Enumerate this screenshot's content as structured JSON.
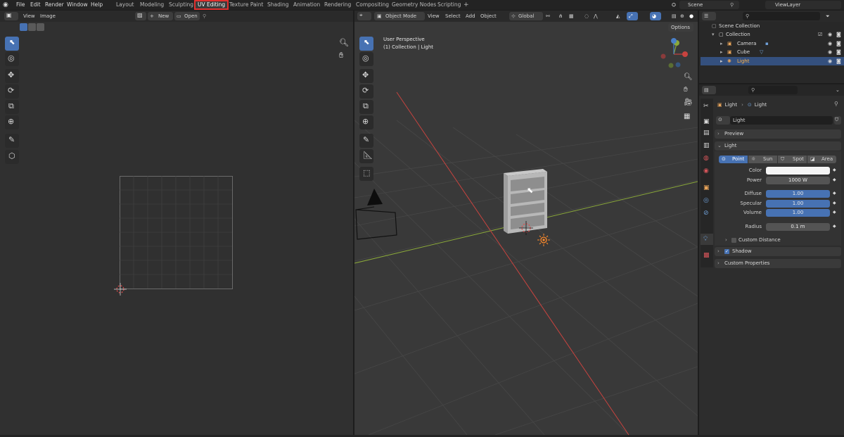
{
  "menus": [
    "File",
    "Edit",
    "Render",
    "Window",
    "Help"
  ],
  "workspaces": [
    {
      "label": "Layout",
      "active": false
    },
    {
      "label": "Modeling",
      "active": false
    },
    {
      "label": "Sculpting",
      "active": false
    },
    {
      "label": "UV Editing",
      "active": true
    },
    {
      "label": "Texture Paint",
      "active": false
    },
    {
      "label": "Shading",
      "active": false
    },
    {
      "label": "Animation",
      "active": false
    },
    {
      "label": "Rendering",
      "active": false
    },
    {
      "label": "Compositing",
      "active": false
    },
    {
      "label": "Geometry Nodes",
      "active": false
    },
    {
      "label": "Scripting",
      "active": false
    }
  ],
  "add_workspace": "+",
  "scene": {
    "name": "Scene",
    "view_layer": "ViewLayer"
  },
  "uv_editor": {
    "menus": [
      "View",
      "Image"
    ],
    "new_label": "New",
    "open_label": "Open",
    "new_plus": "+"
  },
  "viewport": {
    "mode": "Object Mode",
    "menus": [
      "View",
      "Select",
      "Add",
      "Object"
    ],
    "transform_orientation": "Global",
    "options_label": "Options",
    "perspective": "User Perspective",
    "collection_info": "(1) Collection | Light",
    "gizmo": {
      "x": "X",
      "y": "Y",
      "z": "Z"
    }
  },
  "outliner": {
    "scene_collection": "Scene Collection",
    "collection": "Collection",
    "items": [
      {
        "label": "Camera",
        "selected": false
      },
      {
        "label": "Cube",
        "selected": false
      },
      {
        "label": "Light",
        "selected": true
      }
    ]
  },
  "properties": {
    "breadcrumb": [
      "Light",
      "Light"
    ],
    "datablock": "Light",
    "preview_label": "Preview",
    "light_panel": "Light",
    "light_types": [
      "Point",
      "Sun",
      "Spot",
      "Area"
    ],
    "active_type": "Point",
    "rows": [
      {
        "label": "Color",
        "value": ""
      },
      {
        "label": "Power",
        "value": "1000 W"
      },
      {
        "label": "Diffuse",
        "value": "1.00"
      },
      {
        "label": "Specular",
        "value": "1.00"
      },
      {
        "label": "Volume",
        "value": "1.00"
      },
      {
        "label": "Radius",
        "value": "0.1 m"
      }
    ],
    "custom_distance": "Custom Distance",
    "shadow": "Shadow",
    "custom_properties": "Custom Properties"
  },
  "colors": {
    "accent": "#4772b3",
    "highlight_box": "#e0302f",
    "x_axis": "#c8433f",
    "y_axis": "#8aa83a"
  }
}
